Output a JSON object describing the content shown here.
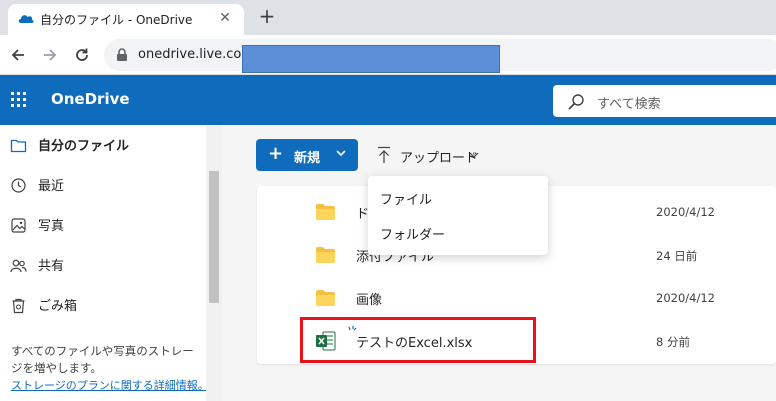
{
  "browser": {
    "tab_title": "自分のファイル - OneDrive",
    "tab_close": "✕",
    "new_tab": "+",
    "url": "onedrive.live.com"
  },
  "header": {
    "brand": "OneDrive",
    "search_placeholder": "すべて検索"
  },
  "sidebar": {
    "items": [
      {
        "label": "自分のファイル",
        "active": true,
        "icon": "folder-icon"
      },
      {
        "label": "最近",
        "icon": "history-icon"
      },
      {
        "label": "写真",
        "icon": "photo-icon"
      },
      {
        "label": "共有",
        "icon": "people-icon"
      },
      {
        "label": "ごみ箱",
        "icon": "trash-icon"
      }
    ],
    "storage_text": "すべてのファイルや写真のストレージを増やします。",
    "storage_link": "ストレージのプランに関する詳細情報。"
  },
  "toolbar": {
    "new_label": "新規",
    "upload_label": "アップロード"
  },
  "upload_menu": {
    "items": [
      "ファイル",
      "フォルダー"
    ]
  },
  "files": [
    {
      "name": "ド",
      "date": "2020/4/12",
      "type": "folder"
    },
    {
      "name": "添付ファイル",
      "date": "24 日前",
      "type": "folder"
    },
    {
      "name": "画像",
      "date": "2020/4/12",
      "type": "folder"
    },
    {
      "name": "テストのExcel.xlsx",
      "date": "8 分前",
      "type": "excel"
    }
  ],
  "colors": {
    "brand_blue": "#0f6cbd",
    "folder_yellow": "#f5c142",
    "excel_green": "#1d7044",
    "highlight_red": "#e8131a"
  }
}
